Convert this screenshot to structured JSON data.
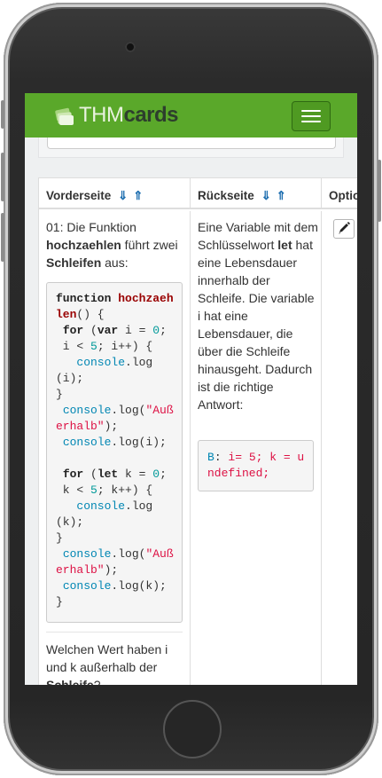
{
  "brand": {
    "thm": "THM",
    "cards": "cards"
  },
  "colors": {
    "navbar": "#5aa82a",
    "sort_arrows": "#1f6fb0"
  },
  "table": {
    "columns": [
      {
        "label": "Vorderseite",
        "sort_down": "⇓",
        "sort_up": "⇑"
      },
      {
        "label": "Rückseite",
        "sort_down": "⇓",
        "sort_up": "⇑"
      },
      {
        "label": "Optio"
      }
    ],
    "row": {
      "front": {
        "intro": {
          "prefix": "01: Die Funktion ",
          "fn_name": "hochzaehlen",
          "middle": " führt zwei ",
          "bold2": "Schleifen",
          "suffix": " aus:"
        },
        "question": {
          "prefix": "Welchen Wert haben i und k außerhalb der ",
          "bold": "Schleife",
          "suffix": "?"
        }
      },
      "back": {
        "text": {
          "prefix": "Eine Variable mit dem Schlüsselwort ",
          "bold": "let",
          "suffix": " hat eine Lebensdauer innerhalb der Schleife. Die variable i hat eine Lebensdauer, die über die Schleife hinausgeht. Dadurch ist die richtige Antwort:"
        }
      }
    }
  }
}
